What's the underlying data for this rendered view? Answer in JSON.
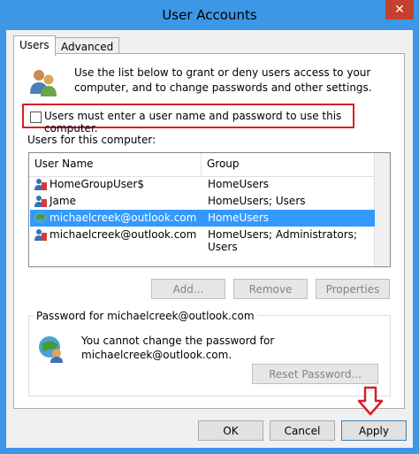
{
  "window": {
    "title": "User Accounts",
    "close_symbol": "✕"
  },
  "tabs": [
    {
      "label": "Users",
      "active": true
    },
    {
      "label": "Advanced",
      "active": false
    }
  ],
  "intro_text": "Use the list below to grant or deny users access to your computer, and to change passwords and other settings.",
  "require_login": {
    "label": "Users must enter a user name and password to use this computer.",
    "checked": false
  },
  "users_section_label": "Users for this computer:",
  "table": {
    "columns": [
      "User Name",
      "Group"
    ],
    "rows": [
      {
        "name": "HomeGroupUser$",
        "group": "HomeUsers",
        "selected": false
      },
      {
        "name": "Jame",
        "group": "HomeUsers; Users",
        "selected": false
      },
      {
        "name": "michaelcreek@outlook.com",
        "group": "HomeUsers",
        "selected": true
      },
      {
        "name": "michaelcreek@outlook.com",
        "group": "HomeUsers; Administrators; Users",
        "selected": false
      }
    ]
  },
  "list_buttons": {
    "add": "Add...",
    "remove": "Remove",
    "properties": "Properties"
  },
  "password_group": {
    "label": "Password for michaelcreek@outlook.com",
    "message_line1": "You cannot change the password for",
    "message_line2": "michaelcreek@outlook.com.",
    "reset_button": "Reset Password..."
  },
  "footer_buttons": {
    "ok": "OK",
    "cancel": "Cancel",
    "apply": "Apply"
  },
  "colors": {
    "title_bar": "#3c97e6",
    "close": "#c7402d",
    "selection": "#3399ff",
    "highlight_box": "#d81f26",
    "arrow": "#d81f26"
  }
}
